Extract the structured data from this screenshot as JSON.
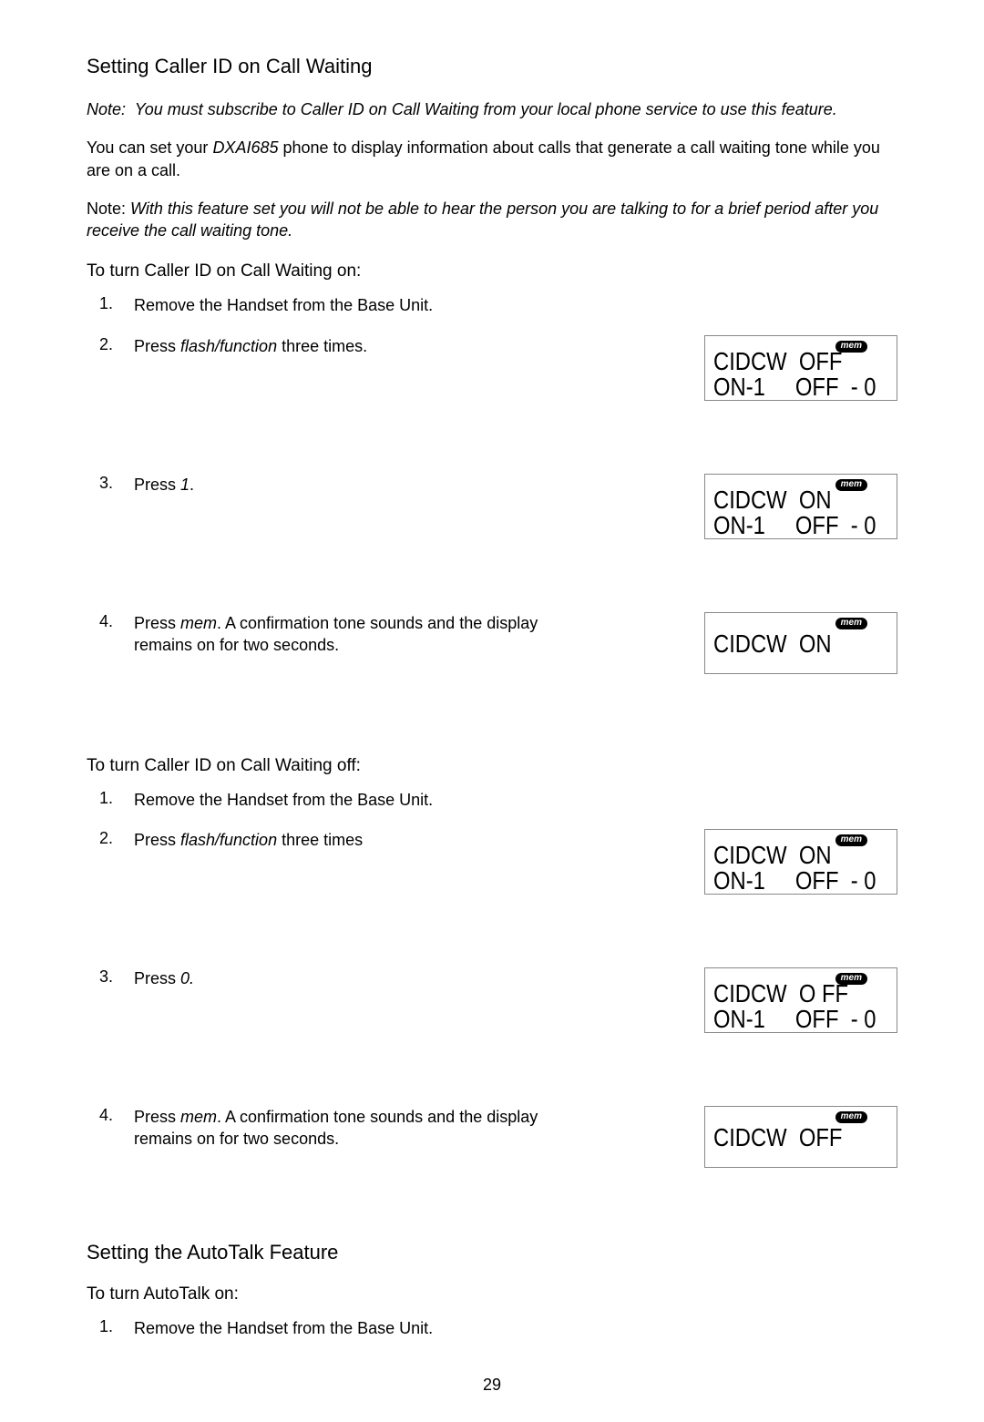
{
  "section1": {
    "title": "Setting Caller ID on Call Waiting",
    "note1_label": "Note:",
    "note1_text": "You must subscribe to Caller ID on Call Waiting from your local phone service to use this feature.",
    "body_pre": "You can set your ",
    "body_model": "DXAI685",
    "body_post": " phone to display information about calls that generate a call waiting tone while you are on a call.",
    "note2_label": "Note:",
    "note2_text": "With this feature set you will not be able to hear the person you are talking to for a brief period after you receive the call waiting tone.",
    "on_head": "To turn Caller ID on Call Waiting on:",
    "on_steps": [
      {
        "n": "1.",
        "t": "Remove the Handset from the Base Unit."
      },
      {
        "n": "2.",
        "t_pre": "Press ",
        "t_k": "flash/function",
        "t_post": "   three times.",
        "lcd": {
          "mem": true,
          "l1": "CIDCW  OFF",
          "l2": "ON-1     OFF  - 0"
        }
      },
      {
        "n": "3.",
        "t_pre": "Press ",
        "t_k": "1",
        "t_post": ".",
        "lcd": {
          "mem": true,
          "l1": "CIDCW  ON",
          "l2": "ON-1     OFF  - 0"
        }
      },
      {
        "n": "4.",
        "t_pre": "Press ",
        "t_k": "mem",
        "t_post": ". A confirmation tone sounds and the display remains on for two seconds.",
        "lcd": {
          "mem": true,
          "single": true,
          "l1": "CIDCW  ON"
        }
      }
    ],
    "off_head": "To turn Caller ID on Call Waiting off:",
    "off_steps": [
      {
        "n": "1.",
        "t": "Remove the Handset from the Base Unit."
      },
      {
        "n": "2.",
        "t_pre": "Press ",
        "t_k": "flash/function",
        "t_post": "   three times",
        "lcd": {
          "mem": true,
          "l1": "CIDCW  ON",
          "l2": "ON-1     OFF  - 0"
        }
      },
      {
        "n": "3.",
        "t_pre": "Press ",
        "t_k": "0.",
        "t_post": "",
        "lcd": {
          "mem": true,
          "l1": "CIDCW  O FF",
          "l2": "ON-1     OFF  - 0"
        }
      },
      {
        "n": "4.",
        "t_pre": "Press ",
        "t_k": "mem",
        "t_post": ". A confirmation tone sounds and the display remains on for two seconds.",
        "lcd": {
          "mem": true,
          "single": true,
          "l1": "CIDCW  OFF"
        }
      }
    ]
  },
  "section2": {
    "title": "Setting the AutoTalk Feature",
    "on_head": "To turn AutoTalk on:",
    "step1_n": "1.",
    "step1_t": "Remove the Handset from the Base Unit."
  },
  "mem_label": "mem",
  "page_number": "29"
}
